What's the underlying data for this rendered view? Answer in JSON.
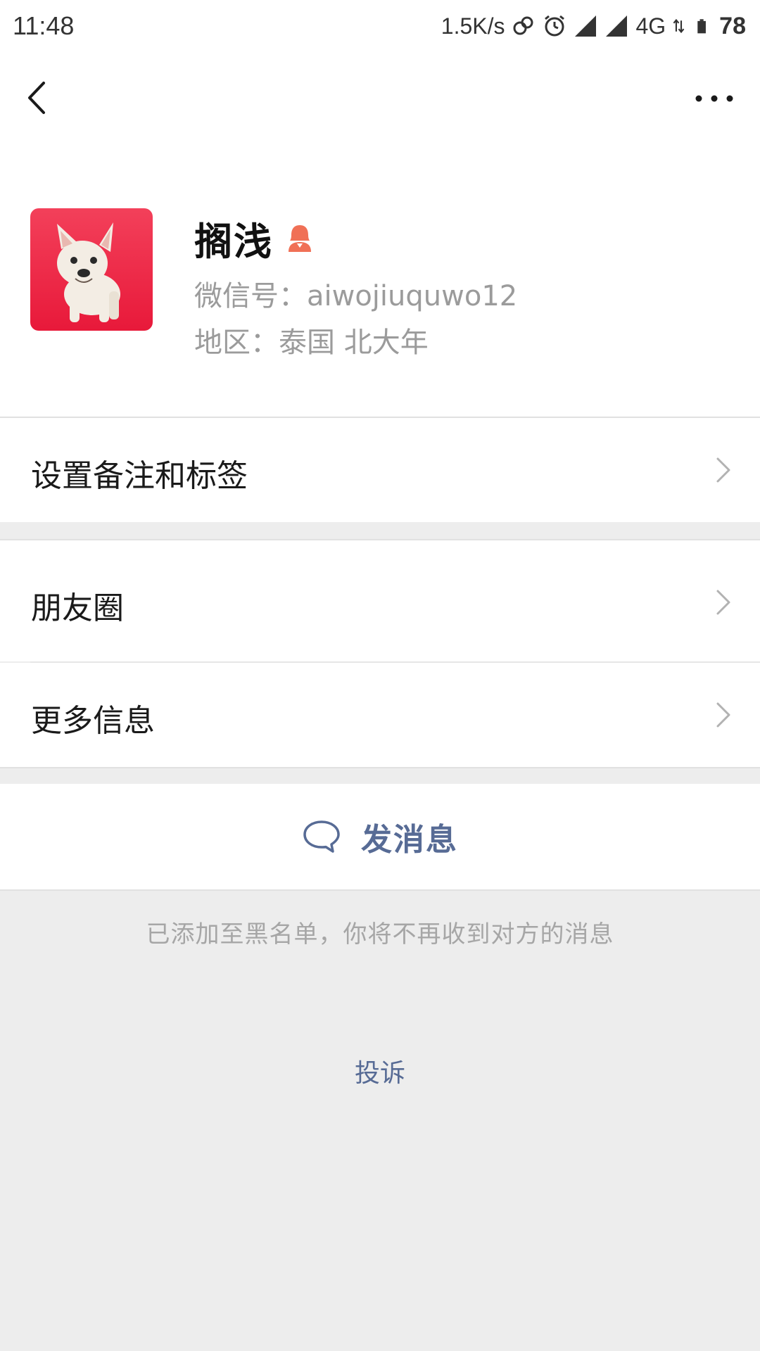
{
  "status_bar": {
    "time": "11:48",
    "network_speed": "1.5K/s",
    "network_type": "4G",
    "battery": "78",
    "icons": [
      "link-icon",
      "alarm-icon",
      "signal-icon",
      "signal-icon",
      "data-arrows-icon",
      "battery-icon"
    ]
  },
  "header": {
    "back_icon": "chevron-left-icon",
    "more_icon": "more-dots-icon"
  },
  "profile": {
    "name": "搁浅",
    "gender_icon": "female-user-icon",
    "wechat_id": "微信号：aiwojiuquwo12",
    "region": "地区：泰国  北大年",
    "avatar_colors": [
      "#f3405a",
      "#e8193a"
    ]
  },
  "rows": {
    "remark": "设置备注和标签",
    "moments": "朋友圈",
    "more_info": "更多信息"
  },
  "send_message": {
    "label": "发消息",
    "icon": "chat-bubble-icon"
  },
  "blacklist_note": "已添加至黑名单，你将不再收到对方的消息",
  "report": "投诉",
  "colors": {
    "link_blue": "#576b95",
    "background": "#ededed",
    "female_icon": "#f07056"
  }
}
